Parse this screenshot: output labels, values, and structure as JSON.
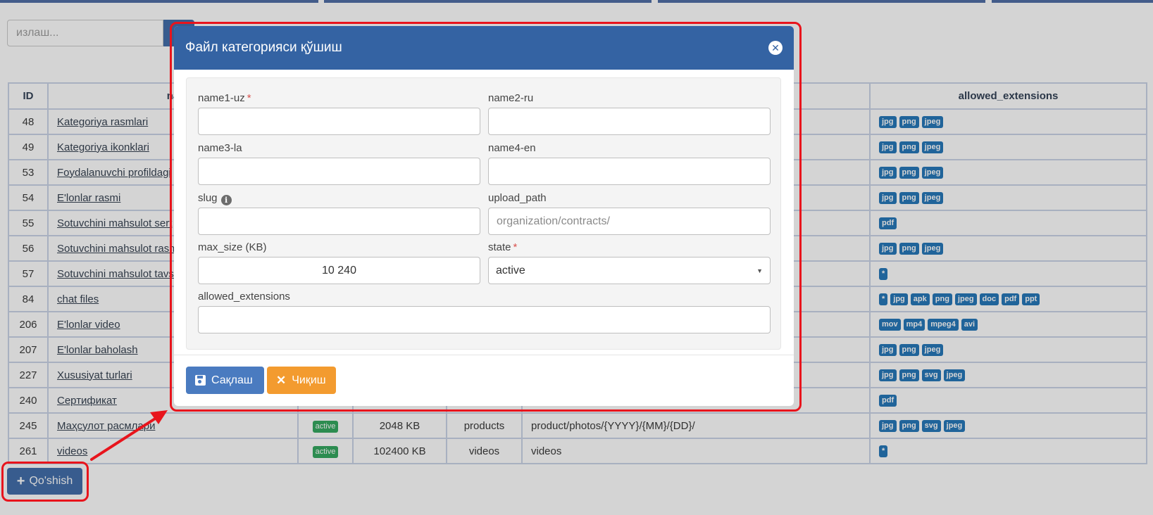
{
  "colors": {
    "primary": "#3463a3",
    "warning": "#f39b2f",
    "badge": "#1f73b7",
    "active": "#2ea65a",
    "highlight": "#e8141c"
  },
  "search": {
    "placeholder": "излаш...",
    "button_icon": "search-icon"
  },
  "table": {
    "headers": {
      "id": "ID",
      "name": "na",
      "allowed_extensions": "allowed_extensions"
    },
    "rows": [
      {
        "id": "48",
        "name": "Kategoriya rasmlari",
        "state": "",
        "size": "",
        "key": "",
        "path": "",
        "ext": [
          "jpg",
          "png",
          "jpeg"
        ]
      },
      {
        "id": "49",
        "name": "Kategoriya ikonklari",
        "state": "",
        "size": "",
        "key": "",
        "path": "",
        "ext": [
          "jpg",
          "png",
          "jpeg"
        ]
      },
      {
        "id": "53",
        "name": "Foydalanuvchi profildagi",
        "state": "",
        "size": "",
        "key": "",
        "path": "",
        "ext": [
          "jpg",
          "png",
          "jpeg"
        ]
      },
      {
        "id": "54",
        "name": "E'lonlar rasmi",
        "state": "",
        "size": "",
        "key": "",
        "path": "",
        "ext": [
          "jpg",
          "png",
          "jpeg"
        ]
      },
      {
        "id": "55",
        "name": "Sotuvchini mahsulot sert",
        "state": "",
        "size": "",
        "key": "",
        "path": "",
        "ext": [
          "pdf"
        ]
      },
      {
        "id": "56",
        "name": "Sotuvchini mahsulot rasm",
        "state": "",
        "size": "",
        "key": "",
        "path": "",
        "ext": [
          "jpg",
          "png",
          "jpeg"
        ]
      },
      {
        "id": "57",
        "name": "Sotuvchini mahsulot tavs",
        "state": "",
        "size": "",
        "key": "",
        "path": "",
        "ext": [
          "*"
        ]
      },
      {
        "id": "84",
        "name": "chat files",
        "state": "",
        "size": "",
        "key": "",
        "path": "",
        "ext": [
          "*",
          "jpg",
          "apk",
          "png",
          "jpeg",
          "doc",
          "pdf",
          "ppt"
        ]
      },
      {
        "id": "206",
        "name": "E'lonlar video",
        "state": "",
        "size": "",
        "key": "",
        "path": "",
        "ext": [
          "mov",
          "mp4",
          "mpeg4",
          "avi"
        ]
      },
      {
        "id": "207",
        "name": "E'lonlar baholash",
        "state": "",
        "size": "",
        "key": "",
        "path": "",
        "ext": [
          "jpg",
          "png",
          "jpeg"
        ]
      },
      {
        "id": "227",
        "name": "Xususiyat turlari",
        "state": "",
        "size": "",
        "key": "",
        "path": "",
        "ext": [
          "jpg",
          "png",
          "svg",
          "jpeg"
        ]
      },
      {
        "id": "240",
        "name": "Сертификат",
        "state": "",
        "size": "",
        "key": "",
        "path": "",
        "ext": [
          "pdf"
        ]
      },
      {
        "id": "245",
        "name": "Маҳсулот расмлари",
        "state": "active",
        "size": "2048 KB",
        "key": "products",
        "path": "product/photos/{YYYY}/{MM}/{DD}/",
        "ext": [
          "jpg",
          "png",
          "svg",
          "jpeg"
        ]
      },
      {
        "id": "261",
        "name": "videos",
        "state": "active",
        "size": "102400 KB",
        "key": "videos",
        "path": "videos",
        "ext": [
          "*"
        ]
      }
    ]
  },
  "add_button": {
    "label": "Qo'shish",
    "icon": "plus-icon"
  },
  "modal": {
    "title": "Файл категорияси қўшиш",
    "close_icon": "close-icon",
    "fields": {
      "name1_uz": {
        "label": "name1-uz",
        "required": "*",
        "value": ""
      },
      "name2_ru": {
        "label": "name2-ru",
        "value": ""
      },
      "name3_la": {
        "label": "name3-la",
        "value": ""
      },
      "name4_en": {
        "label": "name4-en",
        "value": ""
      },
      "slug": {
        "label": "slug",
        "value": "",
        "icon": "info-icon"
      },
      "upload_path": {
        "label": "upload_path",
        "placeholder": "organization/contracts/",
        "value": ""
      },
      "max_size": {
        "label": "max_size (KB)",
        "value": "10 240"
      },
      "state": {
        "label": "state",
        "required": "*",
        "value": "active"
      },
      "allowed_extensions": {
        "label": "allowed_extensions",
        "value": ""
      }
    },
    "save_label": "Сақлаш",
    "exit_label": "Чиқиш"
  }
}
